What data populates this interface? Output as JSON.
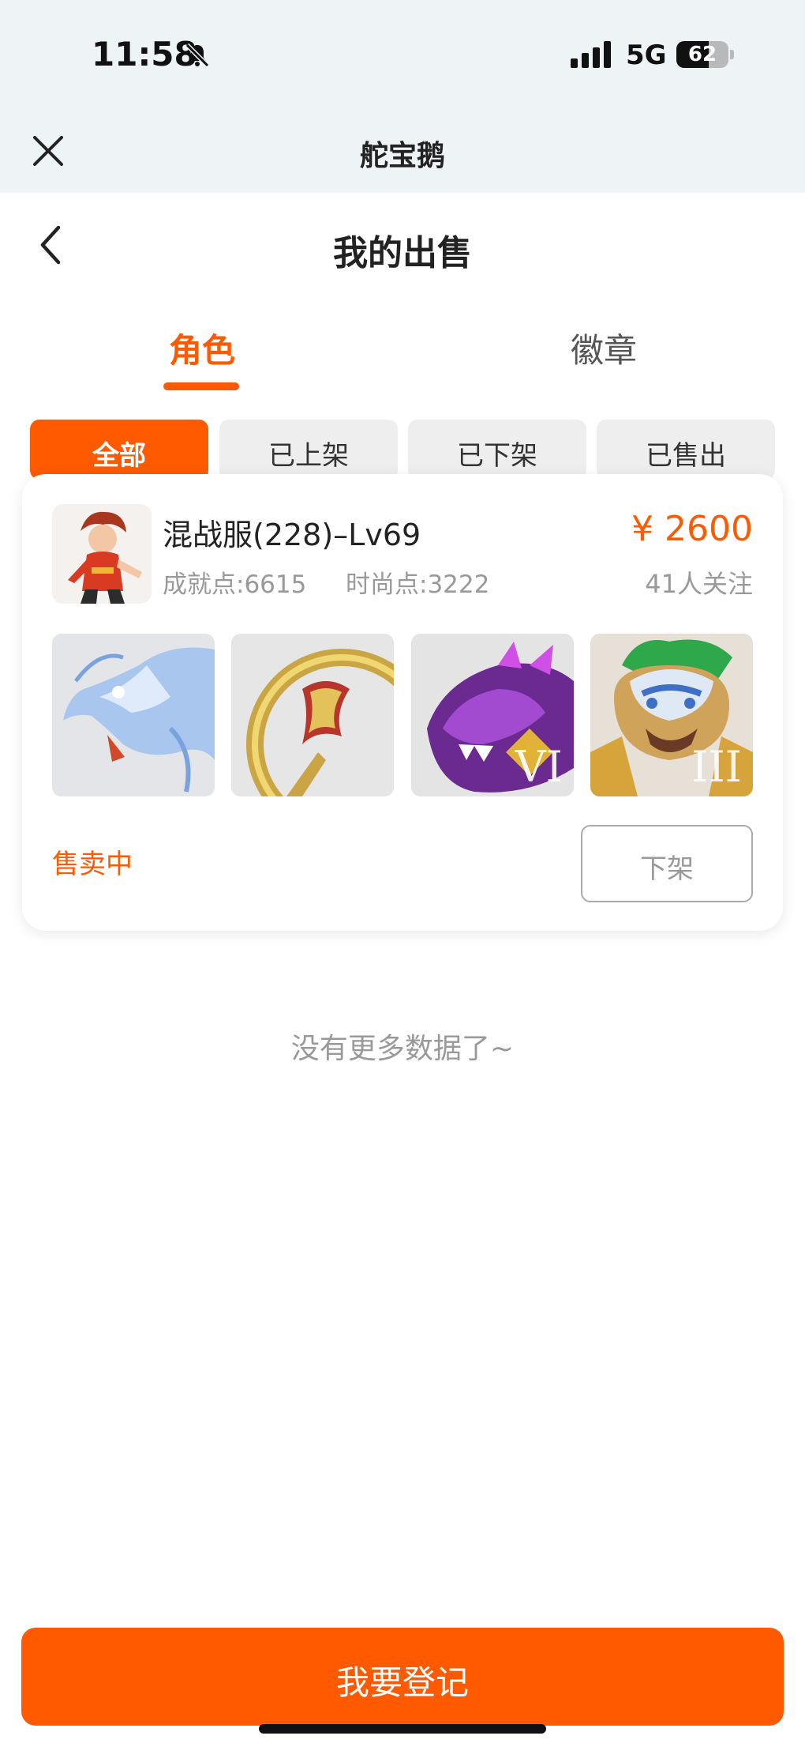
{
  "status_bar": {
    "time": "11:58",
    "network": "5G",
    "battery_level": 62,
    "battery_label": "62"
  },
  "mini_app": {
    "title": "舵宝鹅"
  },
  "header": {
    "title": "我的出售"
  },
  "main_tabs": [
    {
      "label": "角色",
      "active": true
    },
    {
      "label": "徽章",
      "active": false
    }
  ],
  "filters": [
    {
      "label": "全部",
      "active": true
    },
    {
      "label": "已上架",
      "active": false
    },
    {
      "label": "已下架",
      "active": false
    },
    {
      "label": "已售出",
      "active": false
    }
  ],
  "listing": {
    "name": "混战服(228)–Lv69",
    "achievement": "成就点:6615",
    "fashion": "时尚点:3222",
    "price": "¥ 2600",
    "followers": "41人关注",
    "items": [
      {
        "icon": "ice-dragon-icon"
      },
      {
        "icon": "golden-ring-icon"
      },
      {
        "icon": "purple-beast-icon",
        "tier": "VI"
      },
      {
        "icon": "lion-mask-icon",
        "tier": "III"
      }
    ],
    "status": "售卖中",
    "action_label": "下架"
  },
  "footer_note": "没有更多数据了~",
  "primary_action": {
    "label": "我要登记"
  },
  "colors": {
    "accent": "#ff5a00",
    "header_bg": "#eef3f6"
  }
}
